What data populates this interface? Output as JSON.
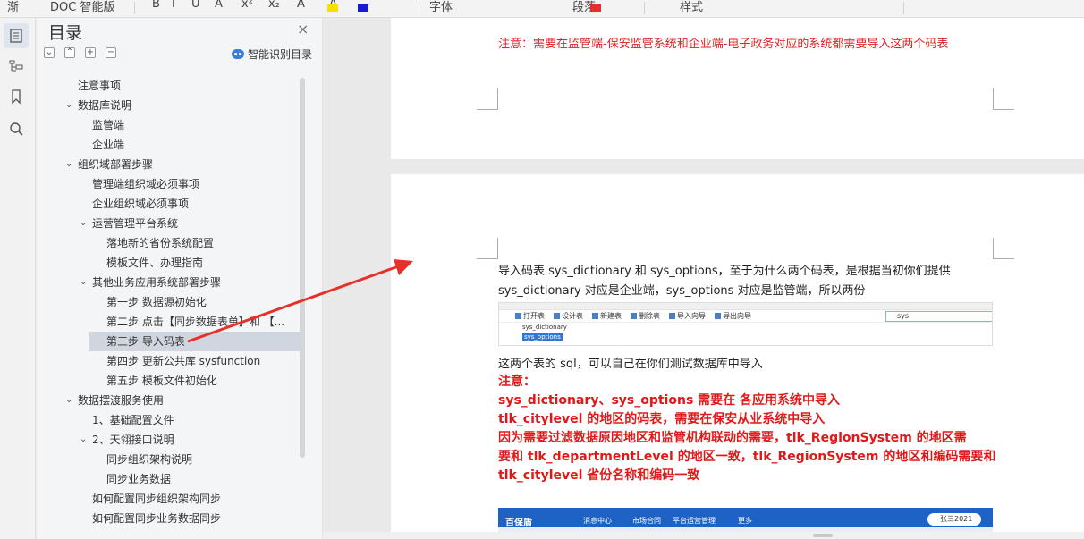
{
  "toolbar": {
    "fragments": [
      "渐",
      "DOC 智能版",
      "B",
      "I",
      "U",
      "A",
      "x²",
      "x₂",
      "A",
      "A",
      "字体",
      "段落",
      "样式"
    ]
  },
  "sidebar": {
    "title": "目录",
    "close_icon": "×",
    "tools": [
      "expand-all",
      "collapse-up",
      "add",
      "remove"
    ],
    "smart_button": "智能识别目录"
  },
  "toc": {
    "items": [
      {
        "label": "注意事项",
        "level": 0,
        "chevron": ""
      },
      {
        "label": "数据库说明",
        "level": 0,
        "chevron": "v"
      },
      {
        "label": "监管端",
        "level": 1,
        "chevron": ""
      },
      {
        "label": "企业端",
        "level": 1,
        "chevron": ""
      },
      {
        "label": "组织域部署步骤",
        "level": 0,
        "chevron": "v"
      },
      {
        "label": "管理端组织域必须事项",
        "level": 1,
        "chevron": ""
      },
      {
        "label": "企业组织域必须事项",
        "level": 1,
        "chevron": ""
      },
      {
        "label": "运营管理平台系统",
        "level": 1,
        "chevron": "v"
      },
      {
        "label": "落地新的省份系统配置",
        "level": 2,
        "chevron": ""
      },
      {
        "label": "模板文件、办理指南",
        "level": 2,
        "chevron": ""
      },
      {
        "label": "其他业务应用系统部署步骤",
        "level": 1,
        "chevron": "v"
      },
      {
        "label": "第一步  数据源初始化",
        "level": 2,
        "chevron": ""
      },
      {
        "label": "第二步  点击【同步数据表单】和 【...",
        "level": 2,
        "chevron": ""
      },
      {
        "label": "第三步  导入码表",
        "level": 2,
        "chevron": "",
        "selected": true
      },
      {
        "label": "第四步  更新公共库 sysfunction",
        "level": 2,
        "chevron": ""
      },
      {
        "label": "第五步  模板文件初始化",
        "level": 2,
        "chevron": ""
      },
      {
        "label": "数据摆渡服务使用",
        "level": 0,
        "chevron": "v"
      },
      {
        "label": "1、基础配置文件",
        "level": 1,
        "chevron": ""
      },
      {
        "label": "2、天翎接口说明",
        "level": 1,
        "chevron": "v"
      },
      {
        "label": "同步组织架构说明",
        "level": 2,
        "chevron": ""
      },
      {
        "label": "同步业务数据",
        "level": 2,
        "chevron": ""
      },
      {
        "label": "如何配置同步组织架构同步",
        "level": 1,
        "chevron": ""
      },
      {
        "label": "如何配置同步业务数据同步",
        "level": 1,
        "chevron": ""
      }
    ]
  },
  "page1": {
    "note": "注意：需要在监管端-保安监管系统和企业端-电子政务对应的系统都需要导入这两个码表"
  },
  "page2": {
    "line1": "导入码表 sys_dictionary 和 sys_options，至于为什么两个码表，是根据当初你们提供",
    "line2": "sys_dictionary 对应是企业端，sys_options 对应是监管端，所以两份",
    "screenshot": {
      "toolbar": [
        "打开表",
        "设计表",
        "新建表",
        "删除表",
        "导入向导",
        "导出向导"
      ],
      "search_value": "sys",
      "rows": [
        "sys_dictionary",
        "sys_options"
      ]
    },
    "line3": "这两个表的 sql，可以自己在你们测试数据库中导入",
    "bold": [
      "注意：",
      "sys_dictionary、sys_options  需要在  各应用系统中导入",
      "tlk_citylevel 的地区的码表，需要在保安从业系统中导入",
      "因为需要过滤数据原因地区和监管机构联动的需要，tlk_RegionSystem 的地区需",
      "要和 tlk_departmentLevel 的地区一致，tlk_RegionSystem 的地区和编码需要和",
      "tlk_citylevel  省份名称和编码一致"
    ],
    "app": {
      "brand": "百保盾",
      "nav": [
        "消息中心",
        "市场合同",
        "平台运营管理",
        "更多"
      ],
      "user": "张三2021"
    }
  },
  "colors": {
    "accent_red": "#e01818",
    "note_red": "#d22222",
    "brand_blue": "#1f62c6",
    "arrow_red": "#e8302a"
  }
}
